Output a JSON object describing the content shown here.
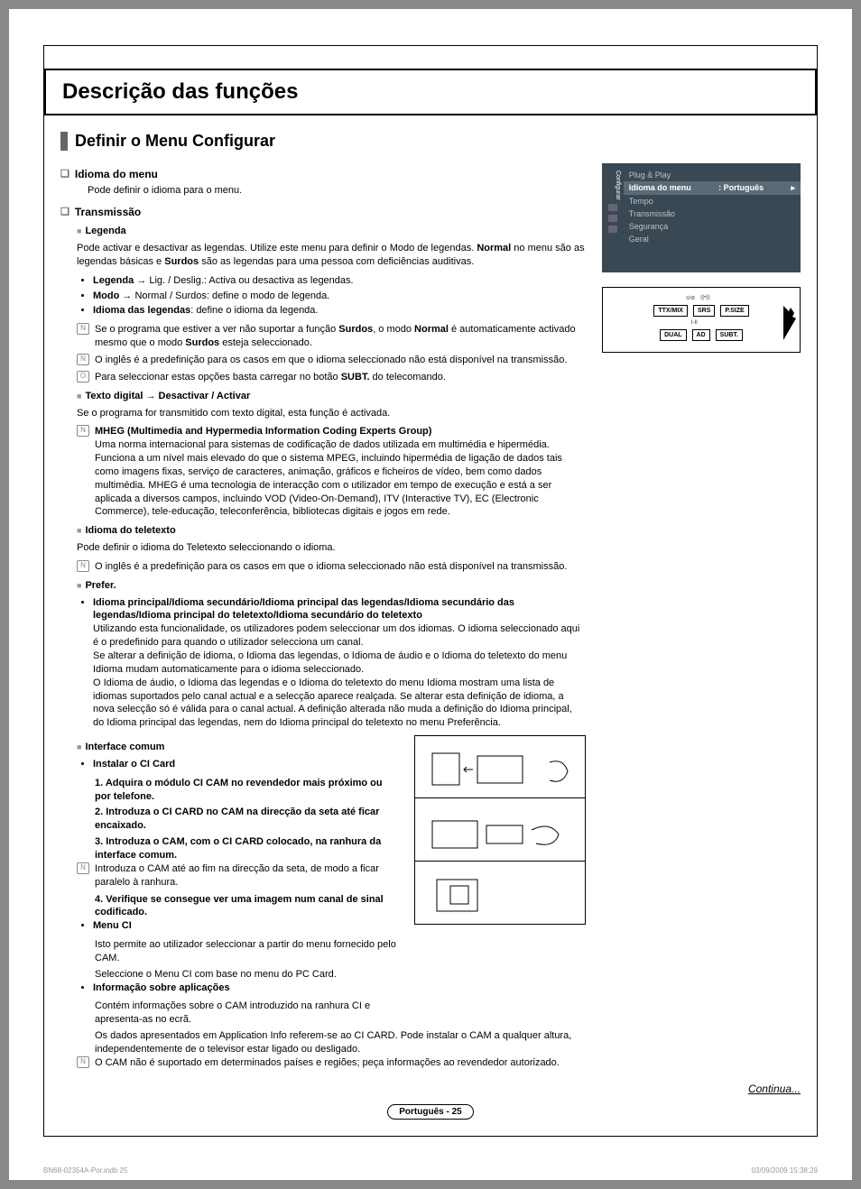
{
  "title": "Descrição das funções",
  "section": "Definir o Menu Configurar",
  "idioma": {
    "h": "Idioma do menu",
    "d": "Pode definir o idioma para o menu."
  },
  "trans": {
    "h": "Transmissão"
  },
  "legenda": {
    "h": "Legenda",
    "d": "Pode activar e desactivar as legendas. Utilize este menu para definir o Modo de legendas. ",
    "d2": " no menu são as legendas básicas e ",
    "d3": " são as legendas para uma pessoa com deficiências auditivas.",
    "normal": "Normal",
    "surdos": "Surdos",
    "bul1a": "Legenda",
    "bul1b": " → Lig. / Deslig.: Activa ou desactiva as legendas.",
    "bul2a": "Modo",
    "bul2b": " → Normal / Surdos: define o modo de legenda.",
    "bul3a": "Idioma das legendas",
    "bul3b": ": define o idioma da legenda.",
    "n1a": "Se o programa que estiver a ver não suportar a função ",
    "n1b": ", o modo ",
    "n1c": " é automaticamente activado mesmo que o modo ",
    "n1d": " esteja seleccionado.",
    "n2": "O inglês é a predefinição para os casos em que o idioma seleccionado não está disponível na transmissão.",
    "n3a": "Para seleccionar estas opções basta carregar no botão ",
    "n3b": " do telecomando.",
    "subt": "SUBT."
  },
  "texto": {
    "h": "Texto digital → Desactivar / Activar",
    "d": "Se o programa for transmitido com texto digital, esta função é activada.",
    "mheg": "MHEG (Multimedia and Hypermedia Information Coding Experts Group)",
    "mhegd": "Uma norma internacional para sistemas de codificação de dados utilizada em multimédia e hipermédia. Funciona a um nível mais elevado do que o sistema MPEG, incluindo hipermédia de ligação de dados tais como imagens fixas, serviço de caracteres, animação, gráficos e ficheiros de vídeo, bem como dados multimédia. MHEG é uma tecnologia de interacção com o utilizador em tempo de execução e está a ser aplicada a diversos campos, incluindo VOD (Video-On-Demand), ITV (Interactive TV), EC (Electronic Commerce), tele-educação, teleconferência, bibliotecas digitais e jogos em rede."
  },
  "teletexto": {
    "h": "Idioma do teletexto",
    "d": "Pode definir o idioma do Teletexto seleccionando o idioma.",
    "n": "O inglês é a predefinição para os casos em que o idioma seleccionado não está disponível na transmissão."
  },
  "prefer": {
    "h": "Prefer.",
    "bh": "Idioma principal/Idioma secundário/Idioma principal das legendas/Idioma secundário das legendas/Idioma principal do teletexto/Idioma secundário do teletexto",
    "p1": "Utilizando esta funcionalidade, os utilizadores podem seleccionar um dos idiomas. O idioma seleccionado aqui é o predefinido para quando o utilizador selecciona um canal.",
    "p2": "Se alterar a definição de idioma, o Idioma das legendas, o Idioma de áudio e o Idioma do teletexto do menu Idioma mudam automaticamente para o idioma seleccionado.",
    "p3": "O Idioma de áudio, o Idioma das legendas e o Idioma do teletexto do menu Idioma mostram uma lista de idiomas suportados pelo canal actual e a selecção aparece realçada. Se alterar esta definição de idioma, a nova selecção só é válida para o canal actual. A definição alterada não muda a definição do Idioma principal, do Idioma principal das legendas, nem do Idioma principal do teletexto no menu Preferência."
  },
  "ci": {
    "h": "Interface comum",
    "instH": "Instalar o CI Card",
    "s1": "1. Adquira o módulo CI CAM no revendedor mais próximo ou por telefone.",
    "s2": "2. Introduza o CI CARD no CAM na direcção da seta até ficar encaixado.",
    "s3": "3. Introduza o CAM, com o CI CARD colocado, na ranhura da interface comum.",
    "s3n": "Introduza o CAM até ao fim na direcção da seta, de modo a ficar paralelo à ranhura.",
    "s4": "4. Verifique se consegue ver uma imagem num canal de sinal codificado.",
    "menuH": "Menu CI",
    "menu1": "Isto permite ao utilizador seleccionar a partir do menu fornecido pelo CAM.",
    "menu2": "Seleccione o Menu CI com base no menu do PC Card.",
    "infoH": "Informação sobre aplicações",
    "info1": "Contém informações sobre o CAM introduzido na ranhura CI e apresenta-as no ecrã.",
    "info2": "Os dados apresentados em Application Info referem-se ao CI CARD. Pode instalar o CAM a qualquer altura, independentemente de o televisor estar ligado ou desligado.",
    "infon": "O CAM não é suportado em determinados países e regiões; peça informações ao revendedor autorizado."
  },
  "menu": {
    "side": "Configurar",
    "items": [
      "Plug & Play",
      "Idioma do menu",
      "Tempo",
      "Transmissão",
      "Segurança",
      "Geral"
    ],
    "val": ": Português"
  },
  "remote": {
    "r1": [
      "TTX/MIX",
      "SRS",
      "P.SIZE"
    ],
    "r2": [
      "DUAL",
      "AD",
      "SUBT."
    ]
  },
  "continua": "Continua...",
  "footer": "Português - 25",
  "meta": {
    "file": "BN68-02354A-Por.indb   25",
    "ts": "03/09/2009   15:38:29"
  }
}
